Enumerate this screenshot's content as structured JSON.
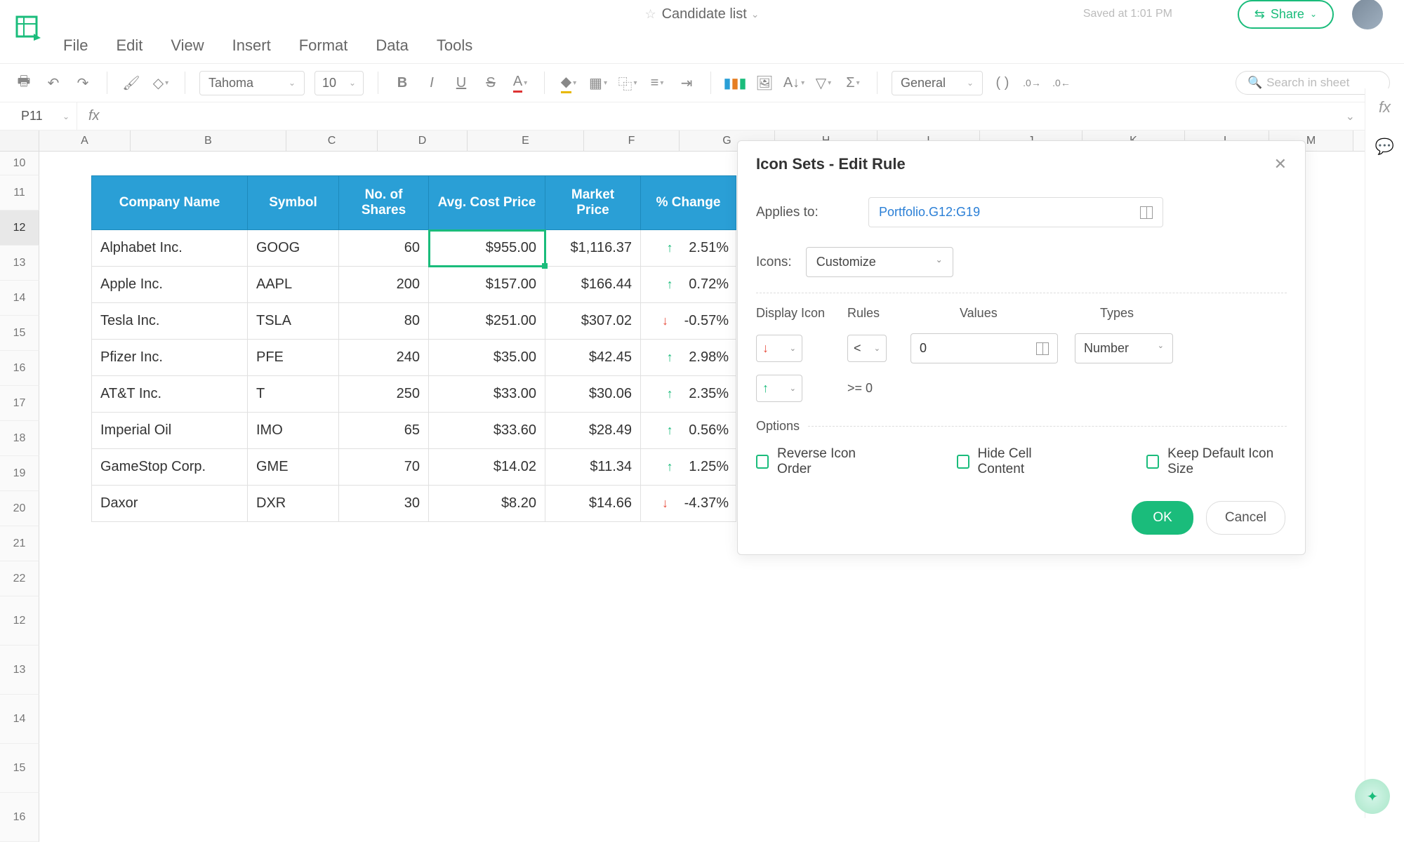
{
  "app": {
    "document_title": "Candidate list",
    "saved_text": "Saved at 1:01 PM",
    "share_label": "Share"
  },
  "menu": [
    "File",
    "Edit",
    "View",
    "Insert",
    "Format",
    "Data",
    "Tools"
  ],
  "toolbar": {
    "font": "Tahoma",
    "font_size": "10",
    "number_format": "General",
    "search_placeholder": "Search in sheet"
  },
  "formula_bar": {
    "cell_ref": "P11"
  },
  "columns": [
    "A",
    "B",
    "C",
    "D",
    "E",
    "F",
    "G",
    "H",
    "I",
    "J",
    "K",
    "L",
    "M"
  ],
  "rows_shown": [
    "10",
    "11",
    "12",
    "13",
    "14",
    "15",
    "16",
    "17",
    "18",
    "19",
    "20",
    "21",
    "22",
    "12",
    "13",
    "14",
    "15",
    "16"
  ],
  "table": {
    "headers": [
      "Company Name",
      "Symbol",
      "No. of Shares",
      "Avg. Cost Price",
      "Market Price",
      "% Change"
    ],
    "rows": [
      {
        "company": "Alphabet Inc.",
        "symbol": "GOOG",
        "shares": "60",
        "cost": "$955.00",
        "market": "$1,116.37",
        "change": "2.51%",
        "dir": "up"
      },
      {
        "company": "Apple Inc.",
        "symbol": "AAPL",
        "shares": "200",
        "cost": "$157.00",
        "market": "$166.44",
        "change": "0.72%",
        "dir": "up"
      },
      {
        "company": "Tesla Inc.",
        "symbol": "TSLA",
        "shares": "80",
        "cost": "$251.00",
        "market": "$307.02",
        "change": "-0.57%",
        "dir": "down"
      },
      {
        "company": "Pfizer Inc.",
        "symbol": "PFE",
        "shares": "240",
        "cost": "$35.00",
        "market": "$42.45",
        "change": "2.98%",
        "dir": "up"
      },
      {
        "company": "AT&T Inc.",
        "symbol": "T",
        "shares": "250",
        "cost": "$33.00",
        "market": "$30.06",
        "change": "2.35%",
        "dir": "up"
      },
      {
        "company": "Imperial Oil",
        "symbol": "IMO",
        "shares": "65",
        "cost": "$33.60",
        "market": "$28.49",
        "change": "0.56%",
        "dir": "up"
      },
      {
        "company": "GameStop Corp.",
        "symbol": "GME",
        "shares": "70",
        "cost": "$14.02",
        "market": "$11.34",
        "change": "1.25%",
        "dir": "up"
      },
      {
        "company": "Daxor",
        "symbol": "DXR",
        "shares": "30",
        "cost": "$8.20",
        "market": "$14.66",
        "change": "-4.37%",
        "dir": "down"
      }
    ]
  },
  "dialog": {
    "title": "Icon Sets - Edit Rule",
    "applies_to_label": "Applies to:",
    "applies_to_value": "Portfolio.G12:G19",
    "icons_label": "Icons:",
    "icons_value": "Customize",
    "headers": {
      "display": "Display Icon",
      "rules": "Rules",
      "values": "Values",
      "types": "Types"
    },
    "rule1": {
      "icon": "down",
      "op": "<",
      "value": "0",
      "type": "Number"
    },
    "rule2": {
      "icon": "up",
      "text": ">= 0"
    },
    "options_label": "Options",
    "opt1": "Reverse Icon Order",
    "opt2": "Hide Cell Content",
    "opt3": "Keep Default Icon Size",
    "ok": "OK",
    "cancel": "Cancel"
  }
}
